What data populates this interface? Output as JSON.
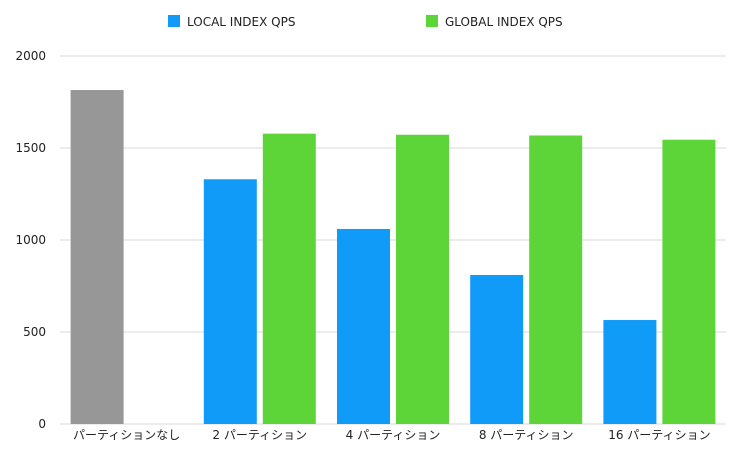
{
  "chart_data": {
    "type": "bar",
    "categories": [
      "パーティションなし",
      "2 パーティション",
      "4 パーティション",
      "8 パーティション",
      "16 パーティション"
    ],
    "ylim": [
      0,
      2000
    ],
    "yticks": [
      0,
      500,
      1000,
      1500,
      2000
    ],
    "yticks_labels": [
      "0",
      "500",
      "1000",
      "1500",
      "2000"
    ],
    "grid": true,
    "legend_position": "top",
    "baseline": {
      "value": 1815,
      "color": "#979797"
    },
    "series": [
      {
        "name": "LOCAL INDEX QPS",
        "color": "#0f9bf7",
        "values": [
          null,
          1330,
          1060,
          810,
          565
        ]
      },
      {
        "name": "GLOBAL INDEX QPS",
        "color": "#5dd539",
        "values": [
          null,
          1578,
          1572,
          1568,
          1545
        ]
      }
    ]
  }
}
